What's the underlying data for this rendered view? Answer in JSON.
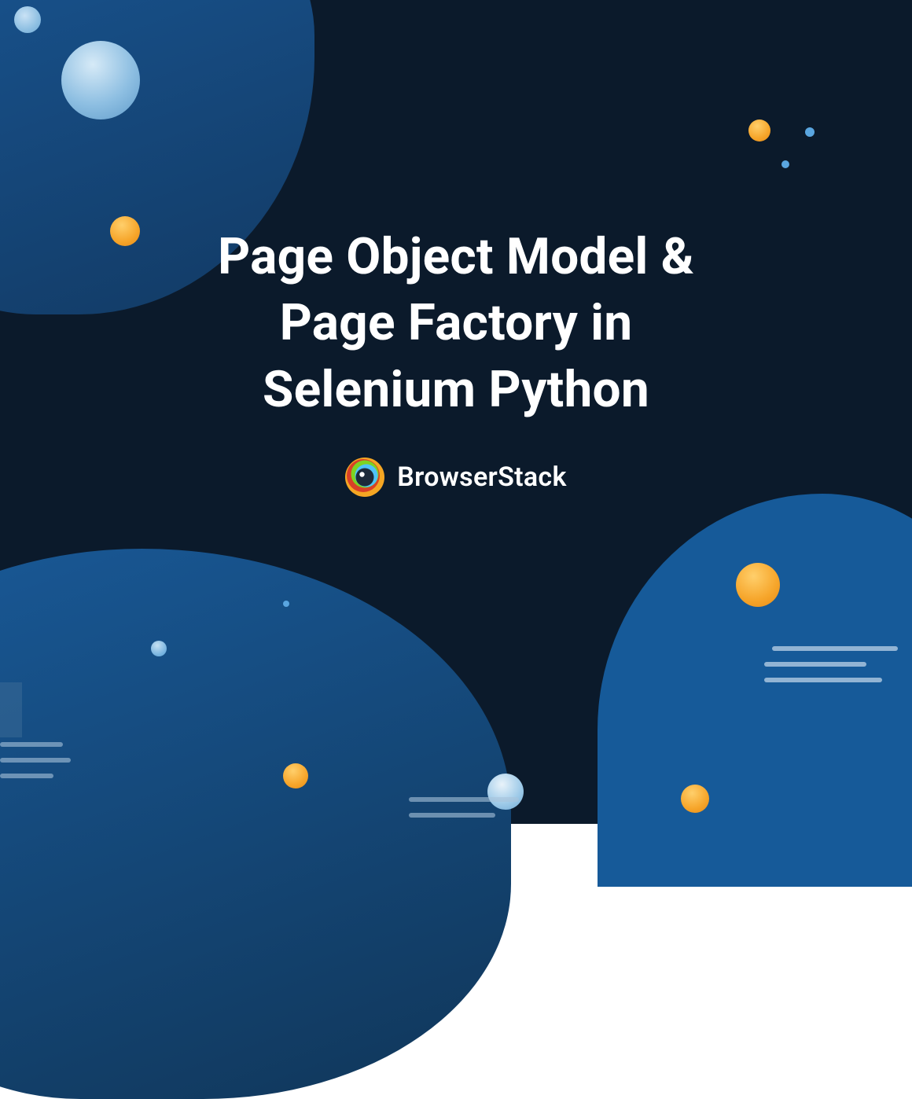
{
  "title_line1": "Page Object Model &",
  "title_line2": "Page Factory in",
  "title_line3": "Selenium Python",
  "brand": {
    "name": "BrowserStack"
  },
  "colors": {
    "background": "#0b1a2b",
    "accent_orange": "#f6a52a",
    "accent_blue": "#5aa6e0",
    "text": "#ffffff"
  }
}
